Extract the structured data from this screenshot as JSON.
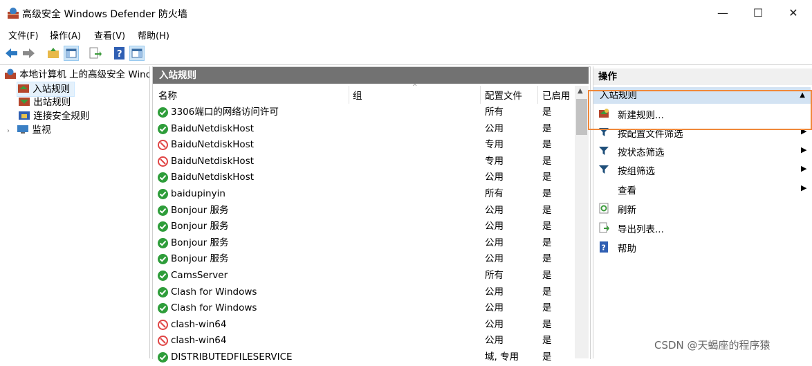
{
  "window": {
    "title": "高级安全 Windows Defender 防火墙",
    "minimize": "—",
    "maximize": "☐",
    "close": "✕"
  },
  "menu": [
    "文件(F)",
    "操作(A)",
    "查看(V)",
    "帮助(H)"
  ],
  "toolbar_icons": [
    "back-arrow-icon",
    "forward-arrow-icon",
    "folder-up-icon",
    "show-hide-tree-icon",
    "export-icon",
    "help-icon",
    "action-pane-icon"
  ],
  "tree": {
    "root": "本地计算机 上的高级安全 Wind",
    "items": [
      "入站规则",
      "出站规则",
      "连接安全规则",
      "监视"
    ]
  },
  "middle": {
    "header": "入站规则",
    "columns": [
      "名称",
      "组",
      "配置文件",
      "已启用"
    ],
    "rows": [
      {
        "name": "3306端口的网络访问许可",
        "profile": "所有",
        "enabled": "是",
        "status": "allow"
      },
      {
        "name": "BaiduNetdiskHost",
        "profile": "公用",
        "enabled": "是",
        "status": "allow"
      },
      {
        "name": "BaiduNetdiskHost",
        "profile": "专用",
        "enabled": "是",
        "status": "block"
      },
      {
        "name": "BaiduNetdiskHost",
        "profile": "专用",
        "enabled": "是",
        "status": "block"
      },
      {
        "name": "BaiduNetdiskHost",
        "profile": "公用",
        "enabled": "是",
        "status": "allow"
      },
      {
        "name": "baidupinyin",
        "profile": "所有",
        "enabled": "是",
        "status": "allow"
      },
      {
        "name": "Bonjour 服务",
        "profile": "公用",
        "enabled": "是",
        "status": "allow"
      },
      {
        "name": "Bonjour 服务",
        "profile": "公用",
        "enabled": "是",
        "status": "allow"
      },
      {
        "name": "Bonjour 服务",
        "profile": "公用",
        "enabled": "是",
        "status": "allow"
      },
      {
        "name": "Bonjour 服务",
        "profile": "公用",
        "enabled": "是",
        "status": "allow"
      },
      {
        "name": "CamsServer",
        "profile": "所有",
        "enabled": "是",
        "status": "allow"
      },
      {
        "name": "Clash for Windows",
        "profile": "公用",
        "enabled": "是",
        "status": "allow"
      },
      {
        "name": "Clash for Windows",
        "profile": "公用",
        "enabled": "是",
        "status": "allow"
      },
      {
        "name": "clash-win64",
        "profile": "公用",
        "enabled": "是",
        "status": "block"
      },
      {
        "name": "clash-win64",
        "profile": "公用",
        "enabled": "是",
        "status": "block"
      },
      {
        "name": "DISTRIBUTEDFILESERVICE",
        "profile": "域, 专用",
        "enabled": "是",
        "status": "allow"
      }
    ]
  },
  "actions": {
    "header": "操作",
    "section": "入站规则",
    "items": [
      {
        "label": "新建规则...",
        "icon": "new-rule-icon",
        "submenu": false
      },
      {
        "label": "按配置文件筛选",
        "icon": "filter-icon",
        "submenu": true
      },
      {
        "label": "按状态筛选",
        "icon": "filter-icon",
        "submenu": true
      },
      {
        "label": "按组筛选",
        "icon": "filter-icon",
        "submenu": true
      },
      {
        "label": "查看",
        "icon": "",
        "submenu": true
      },
      {
        "label": "刷新",
        "icon": "refresh-icon",
        "submenu": false
      },
      {
        "label": "导出列表...",
        "icon": "export-list-icon",
        "submenu": false
      },
      {
        "label": "帮助",
        "icon": "help-icon",
        "submenu": false
      }
    ]
  },
  "watermark": "CSDN @天蝎座的程序猿",
  "colors": {
    "accent_highlight": "#f0883a",
    "section_bg": "#d3e3f3",
    "header_bg": "#727272",
    "allow": "#2e9d3a",
    "block": "#e04545"
  }
}
